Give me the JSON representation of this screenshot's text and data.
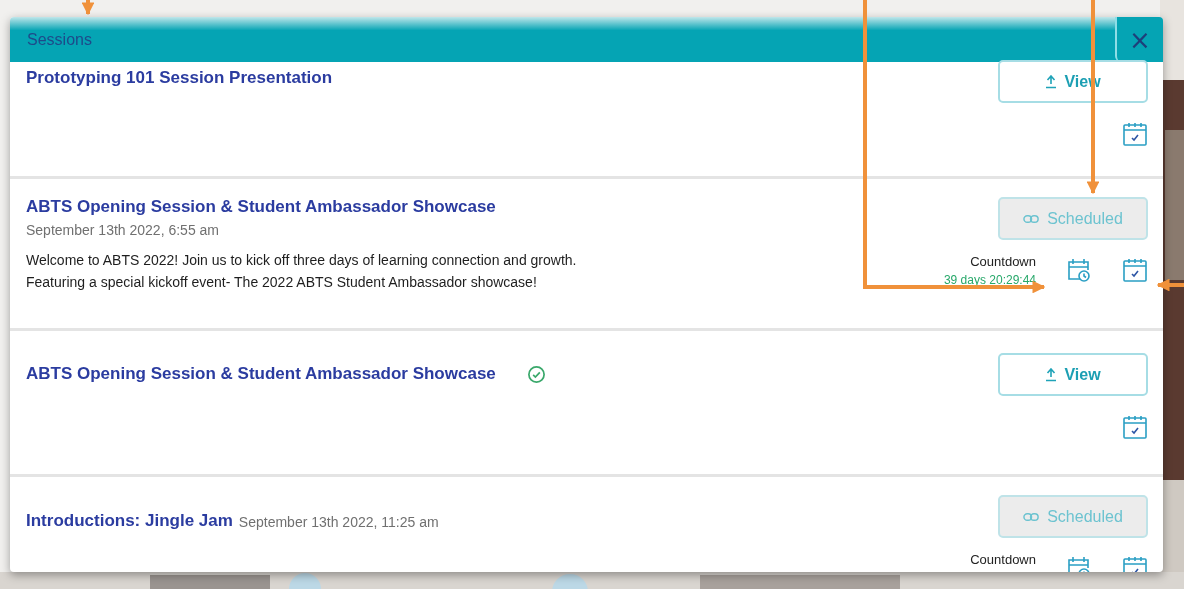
{
  "dialog": {
    "title": "Sessions",
    "close": "×"
  },
  "sessions": [
    {
      "title": "Prototyping 101 Session Presentation",
      "completed": false,
      "button": {
        "kind": "view",
        "label": "View",
        "disabled": false
      }
    },
    {
      "title": "ABTS Opening Session & Student Ambassador Showcase",
      "date": "September 13th 2022, 6:55 am",
      "date_inline": false,
      "description": [
        "Welcome to ABTS 2022! Join us to kick off three days of learning connection and growth.",
        "Featuring a special kickoff event- The 2022 ABTS Student Ambassador showcase!"
      ],
      "completed": false,
      "button": {
        "kind": "link",
        "label": "Scheduled",
        "disabled": true
      },
      "countdown": {
        "label": "Countdown",
        "value": "39 days 20:29:44"
      }
    },
    {
      "title": "ABTS Opening Session & Student Ambassador Showcase",
      "completed": true,
      "button": {
        "kind": "view",
        "label": "View",
        "disabled": false
      }
    },
    {
      "title": "Introductions: Jingle Jam",
      "date": "September 13th 2022, 11:25 am",
      "date_inline": true,
      "completed": false,
      "button": {
        "kind": "link",
        "label": "Scheduled",
        "disabled": true
      },
      "countdown": {
        "label": "Countdown"
      }
    }
  ]
}
